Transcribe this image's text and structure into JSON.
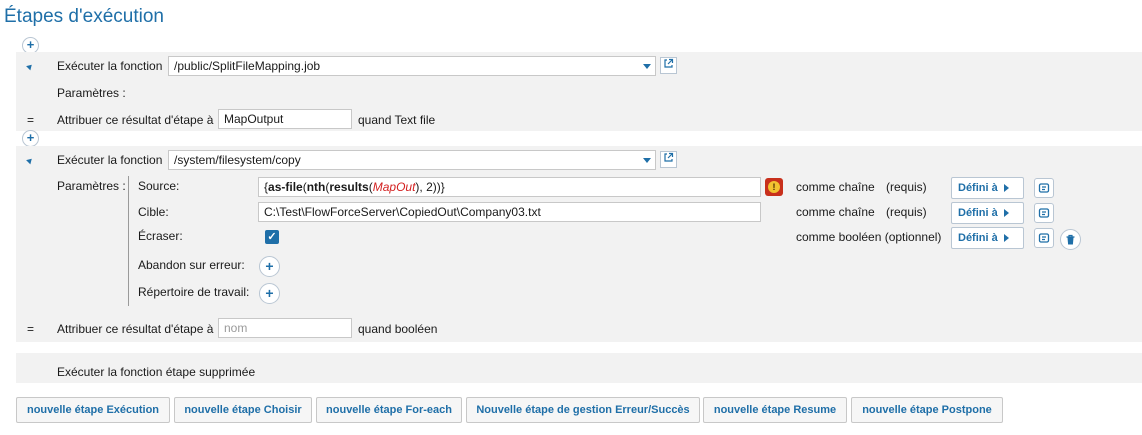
{
  "page_title": "Étapes d'exécution",
  "step1": {
    "exec_label": "Exécuter la fonction",
    "function_path": "/public/SplitFileMapping.job",
    "params_label": "Paramètres :",
    "eq": "=",
    "assign_label": "Attribuer ce résultat d'étape à",
    "result_var": "MapOutput",
    "when_label": "quand Text file"
  },
  "step2": {
    "exec_label": "Exécuter la fonction",
    "function_path": "/system/filesystem/copy",
    "params_label": "Paramètres :",
    "params": [
      {
        "name": "Source:",
        "expr": {
          "open": "{",
          "f1": "as-file",
          "p1": "(",
          "f2": "nth",
          "p2": "(",
          "f3": "results",
          "p3": "(",
          "var": "MapOut",
          "p4": "), ",
          "num": "2",
          "close": "))}"
        },
        "type": "comme chaîne",
        "req": "(requis)",
        "define": "Défini à"
      },
      {
        "name": "Cible:",
        "value": "C:\\Test\\FlowForceServer\\CopiedOut\\Company03.txt",
        "type": "comme chaîne",
        "req": "(requis)",
        "define": "Défini à"
      },
      {
        "name": "Écraser:",
        "checked": true,
        "type": "comme booléen (optionnel)",
        "define": "Défini à"
      },
      {
        "name": "Abandon sur erreur:"
      },
      {
        "name": "Répertoire de travail:"
      }
    ],
    "eq": "=",
    "assign_label": "Attribuer ce résultat d'étape à",
    "result_placeholder": "nom",
    "when_label": "quand booléen"
  },
  "deleted_step_text": "Exécuter la fonction étape supprimée",
  "bottom_buttons": [
    "nouvelle étape Exécution",
    "nouvelle étape Choisir",
    "nouvelle étape For-each",
    "Nouvelle étape de gestion Erreur/Succès",
    "nouvelle étape Resume",
    "nouvelle étape Postpone"
  ],
  "colors": {
    "accent": "#1f6fa8",
    "band": "#f2f2f2",
    "variable": "#d32020",
    "warning": "#c8301c"
  },
  "icons": {
    "plus": "+",
    "caret": "chevron-down-icon",
    "external": "external-link-icon",
    "warning": "info-warning-icon",
    "variable": "variable-icon",
    "trash": "trash-icon",
    "check": "✓"
  }
}
